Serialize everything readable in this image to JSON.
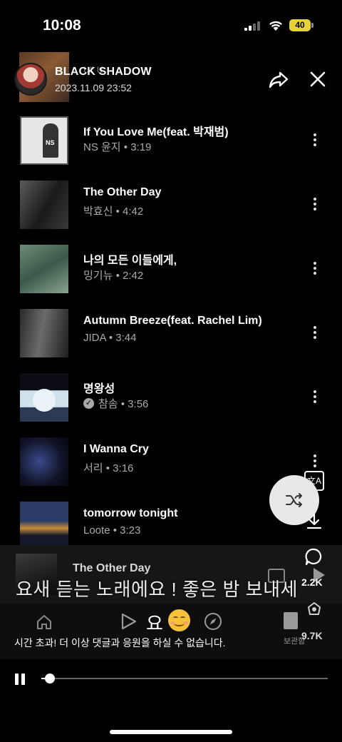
{
  "status_bar": {
    "time": "10:08",
    "battery": "40"
  },
  "header": {
    "channel_name": "BLACK SHADOW",
    "posted_at": "2023.11.09 23:52",
    "overlap_text": "ur  u"
  },
  "songs": [
    {
      "title": "If You Love Me(feat. 박재범)",
      "artist": "NS 윤지",
      "duration": "3:19",
      "verified": false,
      "meta": "NS 윤지 • 3:19"
    },
    {
      "title": "The Other Day",
      "artist": "박효신",
      "duration": "4:42",
      "verified": false,
      "meta": "박효신 • 4:42"
    },
    {
      "title": "나의 모든 이들에게,",
      "artist": "밍기뉴",
      "duration": "2:42",
      "verified": false,
      "meta": "밍기뉴 • 2:42"
    },
    {
      "title": "Autumn Breeze(feat. Rachel Lim)",
      "artist": "JIDA",
      "duration": "3:44",
      "verified": false,
      "meta": "JIDA • 3:44"
    },
    {
      "title": "명왕성",
      "artist": "참솜",
      "duration": "3:56",
      "verified": true,
      "meta": "참솜 • 3:56"
    },
    {
      "title": "I Wanna Cry",
      "artist": "서리",
      "duration": "3:16",
      "verified": false,
      "meta": "서리 • 3:16"
    },
    {
      "title": "tomorrow tonight",
      "artist": "Loote",
      "duration": "3:23",
      "verified": false,
      "meta": "Loote • 3:23"
    }
  ],
  "mini_player": {
    "title": "The Other Day"
  },
  "comment": {
    "text": "요새 듣는 노래에요 ! 좋은 밤 보내세",
    "bottom_fragment": "요"
  },
  "bottom_nav": {
    "library_label": "보관함"
  },
  "timeout_message": "시간 초과! 더 이상 댓글과 응원을 하실 수 없습니다.",
  "right_rail": {
    "comments_count": "2.2K",
    "remix_count": "9.7K",
    "translate_label": "文A"
  },
  "player": {
    "progress": 0.03
  },
  "colors": {
    "background": "#000000",
    "battery": "#e8d23a",
    "emoji": "#f6c23a"
  }
}
